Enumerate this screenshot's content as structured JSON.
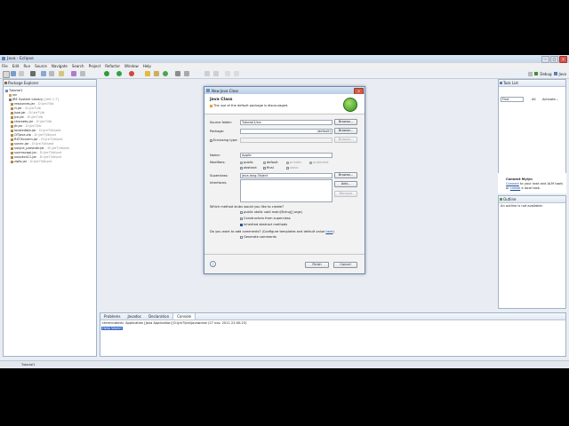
{
  "window": {
    "title": "Java - Eclipse"
  },
  "menu": [
    "File",
    "Edit",
    "Run",
    "Source",
    "Navigate",
    "Search",
    "Project",
    "Refactor",
    "Window",
    "Help"
  ],
  "perspective": {
    "debug": "Debug",
    "java": "Java"
  },
  "package_explorer": {
    "tab": "Package Explorer",
    "project": "Tutorial1",
    "src": "src",
    "jre": "JRE System Library",
    "jre_version": "[jre6 1.7]",
    "jars": [
      {
        "name": "resources.jar",
        "path": "D:\\jre7\\lib"
      },
      {
        "name": "rt.jar",
        "path": "D:\\jre7\\lib"
      },
      {
        "name": "jsse.jar",
        "path": "D:\\jre7\\lib"
      },
      {
        "name": "jce.jar",
        "path": "D:\\jre7\\lib"
      },
      {
        "name": "charsets.jar",
        "path": "D:\\jre7\\lib"
      },
      {
        "name": "jfr.jar",
        "path": "D:\\jre7\\lib"
      },
      {
        "name": "localedata.jar",
        "path": "D:\\jre7\\lib\\ext"
      },
      {
        "name": "QTJava.zip",
        "path": "D:\\jre7\\lib\\ext"
      },
      {
        "name": "RXTXcomm.jar",
        "path": "D:\\jre7\\lib\\ext"
      },
      {
        "name": "sunec.jar",
        "path": "D:\\jre7\\lib\\ext"
      },
      {
        "name": "sunjce_provider.jar",
        "path": "D:\\jre7\\lib\\ext"
      },
      {
        "name": "sunmscapi.jar",
        "path": "D:\\jre7\\lib\\ext"
      },
      {
        "name": "sunpkcs11.jar",
        "path": "D:\\jre7\\lib\\ext"
      },
      {
        "name": "zipfs.jar",
        "path": "D:\\jre7\\lib\\ext"
      }
    ]
  },
  "task_list": {
    "tab": "Task List",
    "find_placeholder": "Find",
    "filter_all": "All",
    "activate": "Activate..."
  },
  "mylyn": {
    "title": "Connect Mylyn",
    "connect": "Connect",
    "middle": " to your task and ALM tools",
    "or": "or ",
    "create": "create",
    "end": " a local task."
  },
  "outline": {
    "tab": "Outline",
    "message": "An outline is not available."
  },
  "console": {
    "tabs": [
      "Problems",
      "Javadoc",
      "Declaration",
      "Console"
    ],
    "header": "<terminated> Application [Java Application] D:\\jre7\\bin\\javaw.exe (27 nov. 2011 22:00:23)",
    "output": "Hello World!"
  },
  "status": {
    "selected": "Tutorial1"
  },
  "dialog": {
    "title": "New Java Class",
    "heading": "Java Class",
    "warning": "The use of the default package is discouraged.",
    "source_folder_label": "Source folder:",
    "source_folder_value": "Tutorial1/src",
    "package_label": "Package:",
    "package_value": "(default)",
    "enclosing_label": "Enclosing type:",
    "name_label": "Name:",
    "name_value": "Applic",
    "modifiers_label": "Modifiers:",
    "mod_public": "public",
    "mod_default": "default",
    "mod_private": "private",
    "mod_protected": "protected",
    "mod_abstract": "abstract",
    "mod_final": "final",
    "mod_static": "static",
    "superclass_label": "Superclass:",
    "superclass_value": "java.lang.Object",
    "interfaces_label": "Interfaces:",
    "browse": "Browse...",
    "add": "Add...",
    "remove": "Remove",
    "stubs_question": "Which method stubs would you like to create?",
    "stub_main": "public static void main(String[] args)",
    "stub_constructors": "Constructors from superclass",
    "stub_inherited": "Inherited abstract methods",
    "comments_question": "Do you want to add comments? (Configure templates and default value ",
    "here": "here",
    "comments_end": ")",
    "generate_comments": "Generate comments",
    "help": "?",
    "finish": "Finish",
    "cancel": "Cancel"
  }
}
